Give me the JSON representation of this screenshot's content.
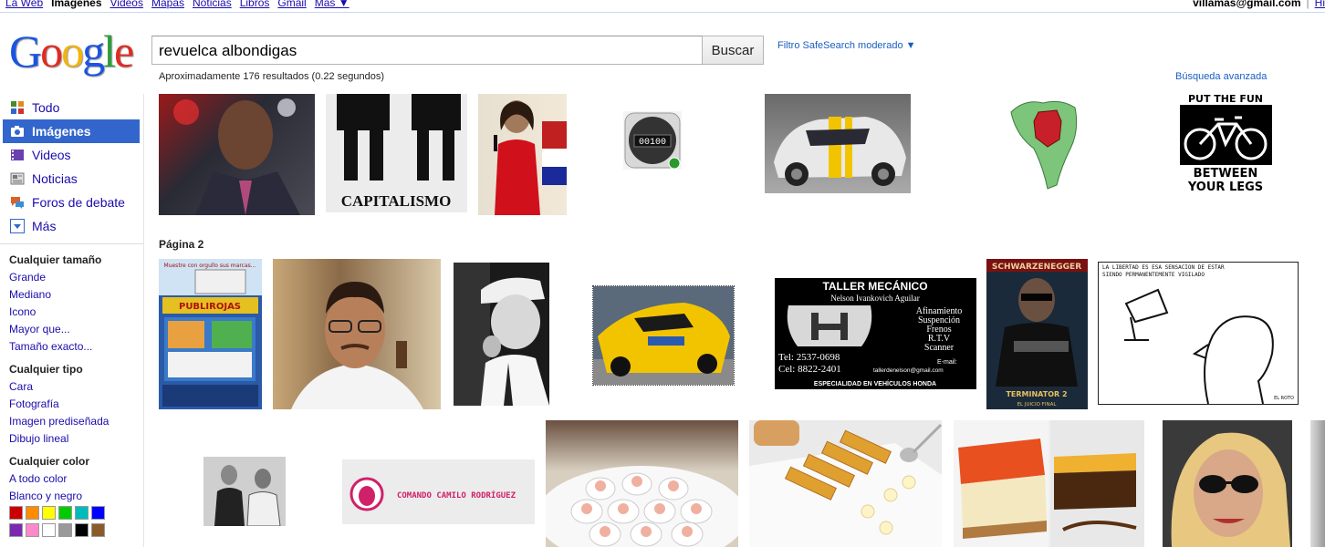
{
  "topnav": {
    "items": [
      "La Web",
      "Imágenes",
      "Videos",
      "Mapas",
      "Noticias",
      "Libros",
      "Gmail",
      "Más ▼"
    ],
    "active_index": 1,
    "account_email": "villamas@gmail.com",
    "right_link": "Hi"
  },
  "logo": {
    "letters": [
      "G",
      "o",
      "o",
      "g",
      "l",
      "e"
    ],
    "colors": [
      "#1a54e1",
      "#e02b22",
      "#f2b50f",
      "#1a54e1",
      "#2c9e3b",
      "#e02b22"
    ]
  },
  "search": {
    "query": "revuelca albondigas",
    "button_label": "Buscar",
    "safesearch": "Filtro SafeSearch moderado ▼",
    "results_count": "Aproximadamente 176 resultados (0.22 segundos)",
    "advanced": "Búsqueda avanzada"
  },
  "sidebar": {
    "nav": [
      {
        "label": "Todo",
        "icon": "web-icon",
        "color": "#4a8a2b"
      },
      {
        "label": "Imágenes",
        "icon": "camera-icon",
        "color": "#ffffff"
      },
      {
        "label": "Videos",
        "icon": "film-icon",
        "color": "#6a3fb0"
      },
      {
        "label": "Noticias",
        "icon": "news-icon",
        "color": "#7a7a7a"
      },
      {
        "label": "Foros de debate",
        "icon": "chat-icon",
        "color": "#e06020"
      },
      {
        "label": "Más",
        "icon": "more-icon",
        "color": "#3366cc"
      }
    ],
    "size_head": "Cualquier tamaño",
    "size_links": [
      "Grande",
      "Mediano",
      "Icono",
      "Mayor que...",
      "Tamaño exacto..."
    ],
    "type_head": "Cualquier tipo",
    "type_links": [
      "Cara",
      "Fotografía",
      "Imagen prediseñada",
      "Dibujo lineal"
    ],
    "color_head": "Cualquier color",
    "color_links": [
      "A todo color",
      "Blanco y negro"
    ],
    "swatches": [
      "#cc0000",
      "#ff8c00",
      "#ffff00",
      "#00cc00",
      "#00bbbb",
      "#0000ff",
      "#7a2ab0",
      "#ff88cc",
      "#ffffff",
      "#999999",
      "#000000",
      "#8b5a2b"
    ]
  },
  "results": {
    "page2_label": "Página 2",
    "capitalismo_text": "CAPITALISMO",
    "counter_text": "00100",
    "putfun_top": "PUT THE FUN",
    "putfun_bottom_1": "BETWEEN",
    "putfun_bottom_2": "YOUR LEGS",
    "flyer_title": "PUBLIROJAS",
    "flyer_top": "Muestre con orgullo sus marcas...",
    "taller": {
      "title": "TALLER MECÁNICO",
      "name": "Nelson Ivankovich Aguilar",
      "services": [
        "Afinamiento",
        "Suspención",
        "Frenos",
        "R.T.V",
        "Scanner"
      ],
      "tel": "Tel: 2537-0698",
      "cel": "Cel: 8822-2401",
      "email_label": "E-mail:",
      "email": "tallerdenelson@gmail.com",
      "footer": "ESPECIALIDAD EN VEHÍCULOS HONDA"
    },
    "terminator_top": "SCHWARZENEGGER",
    "terminator_bottom": "TERMINATOR 2",
    "terminator_sub": "EL JUICIO FINAL",
    "comic_text": "LA LIBERTAD ES ESA SENSACIÓN DE ESTAR SIENDO PERMANENTEMENTE VIGILADO",
    "comic_sign": "EL ROTO",
    "comando_text": "COMANDO CAMILO RODRÍGUEZ"
  }
}
